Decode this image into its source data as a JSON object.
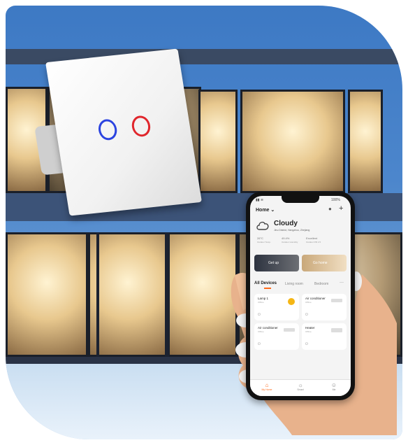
{
  "app": {
    "status_time": "",
    "status_battery": "100%",
    "home_label": "Home",
    "weather": {
      "condition": "Cloudy",
      "location": "Jinu District, Hangzhou, Zhejiang",
      "metrics": [
        {
          "value": "26°C",
          "label": "Outdoor Temp."
        },
        {
          "value": "49.4%",
          "label": "Outdoor Humidity"
        },
        {
          "value": "Excellent",
          "label": "Outdoor PM 2.5"
        }
      ]
    },
    "scenes": [
      {
        "label": "Get up"
      },
      {
        "label": "Go home"
      }
    ],
    "tabs": [
      {
        "label": "All Devices",
        "active": true
      },
      {
        "label": "Living room",
        "active": false
      },
      {
        "label": "Bedroom",
        "active": false
      }
    ],
    "more_label": "···",
    "devices": [
      {
        "name": "Lamp 1",
        "state": "Offline"
      },
      {
        "name": "Air conditioner",
        "state": "Offline"
      },
      {
        "name": "Air conditioner",
        "state": "Offline"
      },
      {
        "name": "Heater",
        "state": "Offline"
      }
    ],
    "nav": [
      {
        "label": "My Home",
        "icon": "home-icon",
        "active": true
      },
      {
        "label": "Smart",
        "icon": "sun-icon",
        "active": false
      },
      {
        "label": "Me",
        "icon": "user-icon",
        "active": false
      }
    ],
    "accent": "#ff6a1a"
  },
  "switch": {
    "button_left_color": "#2c44e0",
    "button_right_color": "#e0262c"
  }
}
